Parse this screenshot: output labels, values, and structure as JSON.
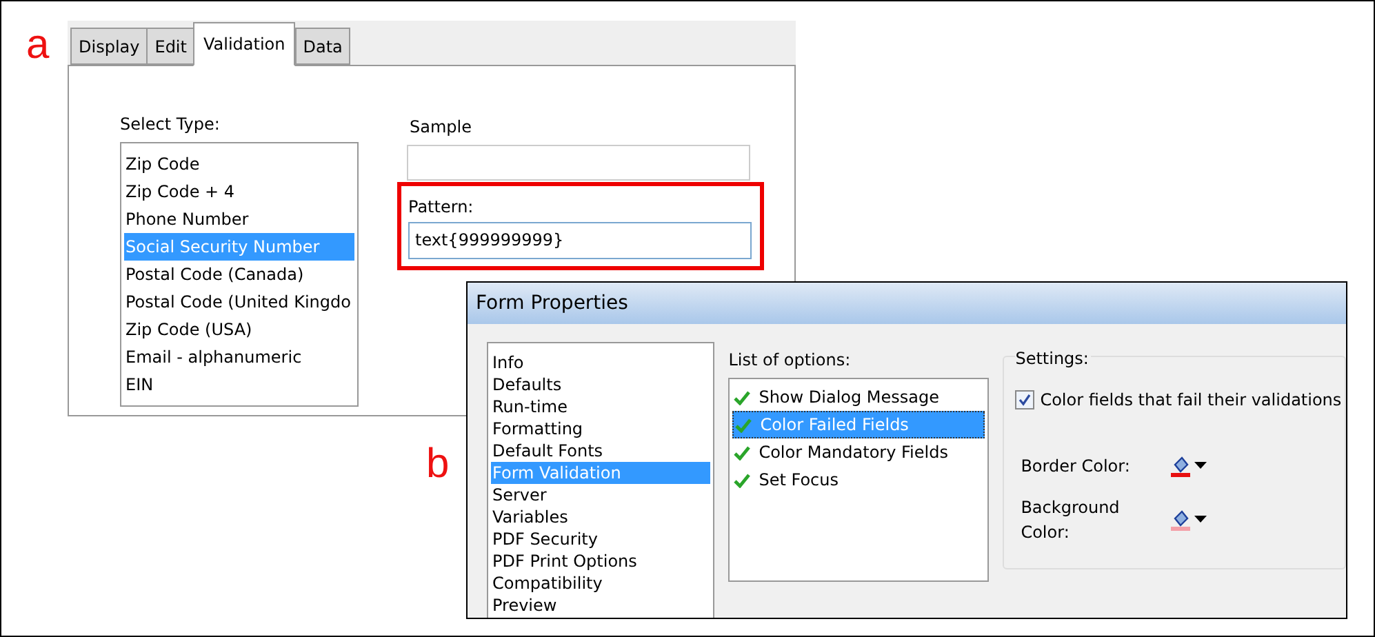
{
  "figure_labels": [
    "a",
    "b"
  ],
  "validation_dialog": {
    "tabs": [
      {
        "label": "Display",
        "selected": false
      },
      {
        "label": "Edit",
        "selected": false
      },
      {
        "label": "Validation",
        "selected": true
      },
      {
        "label": "Data",
        "selected": false
      }
    ],
    "select_type": {
      "label": "Select Type:",
      "items": [
        {
          "label": "Zip Code",
          "selected": false
        },
        {
          "label": "Zip Code + 4",
          "selected": false
        },
        {
          "label": "Phone Number",
          "selected": false
        },
        {
          "label": "Social Security Number",
          "selected": true
        },
        {
          "label": "Postal Code (Canada)",
          "selected": false
        },
        {
          "label": "Postal Code (United Kingdo",
          "selected": false
        },
        {
          "label": "Zip Code (USA)",
          "selected": false
        },
        {
          "label": "Email - alphanumeric",
          "selected": false
        },
        {
          "label": "EIN",
          "selected": false
        }
      ]
    },
    "sample": {
      "label": "Sample"
    },
    "pattern": {
      "label": "Pattern:",
      "value": "text{999999999}",
      "highlighted": true
    }
  },
  "form_properties": {
    "title": "Form Properties",
    "categories": [
      {
        "label": "Info",
        "selected": false
      },
      {
        "label": "Defaults",
        "selected": false
      },
      {
        "label": "Run-time",
        "selected": false
      },
      {
        "label": "Formatting",
        "selected": false
      },
      {
        "label": "Default Fonts",
        "selected": false
      },
      {
        "label": "Form Validation",
        "selected": true
      },
      {
        "label": "Server",
        "selected": false
      },
      {
        "label": "Variables",
        "selected": false
      },
      {
        "label": "PDF Security",
        "selected": false
      },
      {
        "label": "PDF Print Options",
        "selected": false
      },
      {
        "label": "Compatibility",
        "selected": false
      },
      {
        "label": "Preview",
        "selected": false
      }
    ],
    "options": {
      "label": "List of options:",
      "items": [
        {
          "label": "Show Dialog Message",
          "checked": true,
          "selected": false
        },
        {
          "label": "Color Failed Fields",
          "checked": true,
          "selected": true
        },
        {
          "label": "Color Mandatory Fields",
          "checked": true,
          "selected": false
        },
        {
          "label": "Set Focus",
          "checked": true,
          "selected": false
        }
      ]
    },
    "settings": {
      "label": "Settings:",
      "checkbox": {
        "label": "Color fields that fail their validations",
        "checked": true
      },
      "colors": [
        {
          "label": "Border Color:",
          "color": "#e81010"
        },
        {
          "label": "Background Color:",
          "color": "#f4a0a8"
        }
      ]
    }
  }
}
